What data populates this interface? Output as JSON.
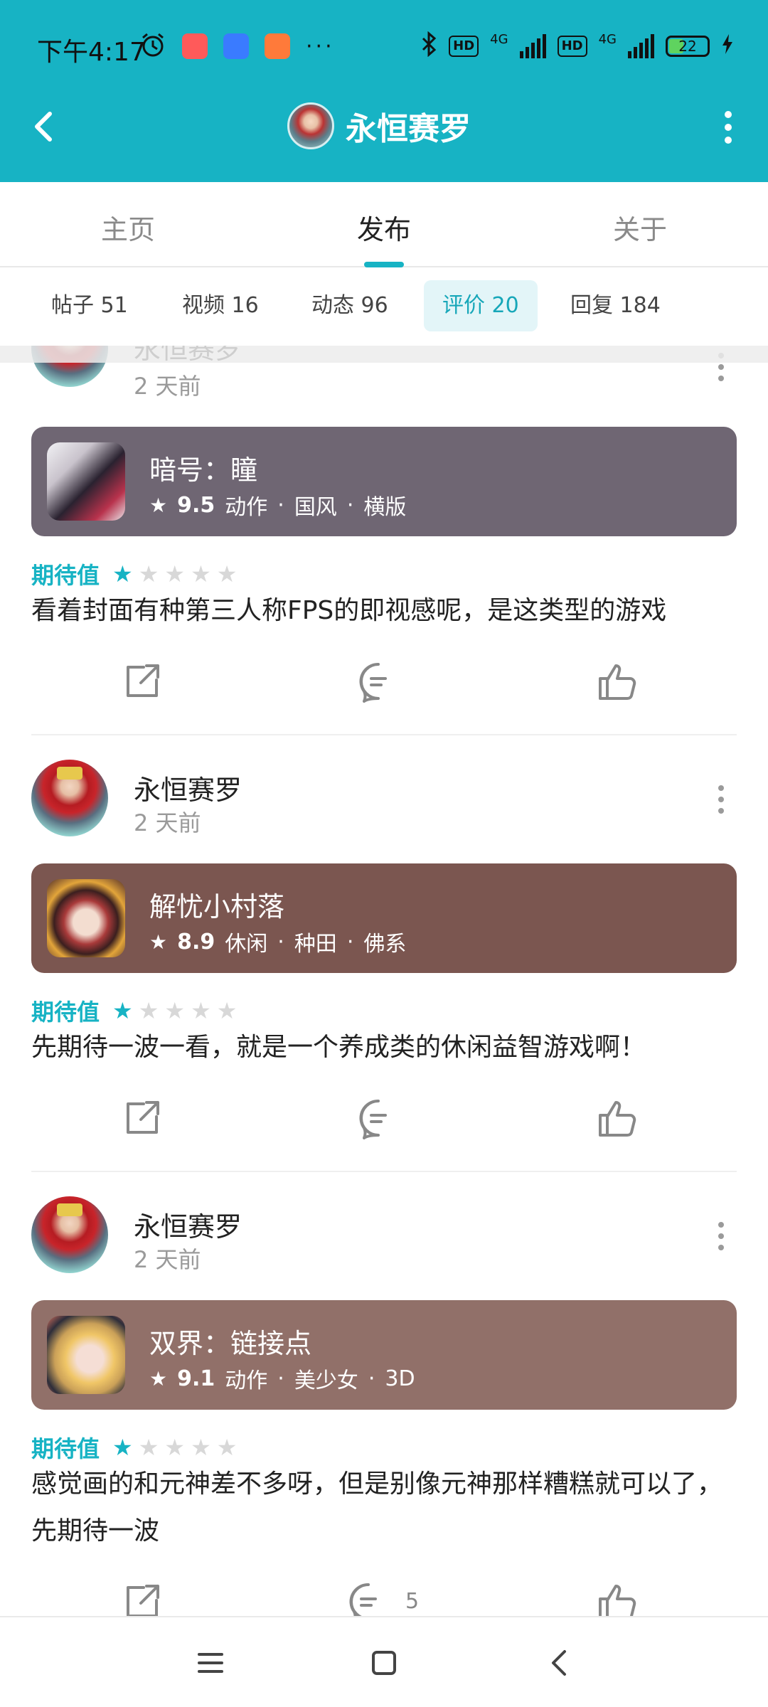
{
  "status_bar": {
    "time": "下午4:17",
    "network_1": "4G",
    "network_2": "4G",
    "hd": "HD",
    "battery": "22",
    "app_icons": [
      "alarm-clock-icon",
      "kuaishou-app-icon",
      "blue-app-icon",
      "orange-app-icon"
    ]
  },
  "header": {
    "title": "永恒赛罗",
    "bg_color": "#17b3c4"
  },
  "main_tabs": [
    {
      "label": "主页",
      "active": false
    },
    {
      "label": "发布",
      "active": true
    },
    {
      "label": "关于",
      "active": false
    }
  ],
  "sub_tabs": [
    {
      "label": "帖子 51",
      "active": false
    },
    {
      "label": "视频 16",
      "active": false
    },
    {
      "label": "动态 96",
      "active": false
    },
    {
      "label": "评价 20",
      "active": true
    },
    {
      "label": "回复 184",
      "active": false
    }
  ],
  "expect_label": "期待值",
  "posts": [
    {
      "author": "永恒赛罗",
      "time": "2 天前",
      "game": {
        "name": "暗号：瞳",
        "score": "9.5",
        "tags": [
          "动作",
          "国风",
          "横版"
        ],
        "bar_color": "#6f6673"
      },
      "rating": 1,
      "text": "看着封面有种第三人称FPS的即视感呢，是这类型的游戏",
      "comment_count": ""
    },
    {
      "author": "永恒赛罗",
      "time": "2 天前",
      "game": {
        "name": "解忧小村落",
        "score": "8.9",
        "tags": [
          "休闲",
          "种田",
          "佛系"
        ],
        "bar_color": "#7b5650"
      },
      "rating": 1,
      "text": "先期待一波一看，就是一个养成类的休闲益智游戏啊！",
      "comment_count": ""
    },
    {
      "author": "永恒赛罗",
      "time": "2 天前",
      "game": {
        "name": "双界：链接点",
        "score": "9.1",
        "tags": [
          "动作",
          "美少女",
          "3D"
        ],
        "bar_color": "#917069"
      },
      "rating": 1,
      "text": "感觉画的和元神差不多呀，但是别像元神那样糟糕就可以了，先期待一波",
      "comment_count": "5"
    }
  ],
  "tag_separator": "·",
  "accent_color": "#17b3c4"
}
